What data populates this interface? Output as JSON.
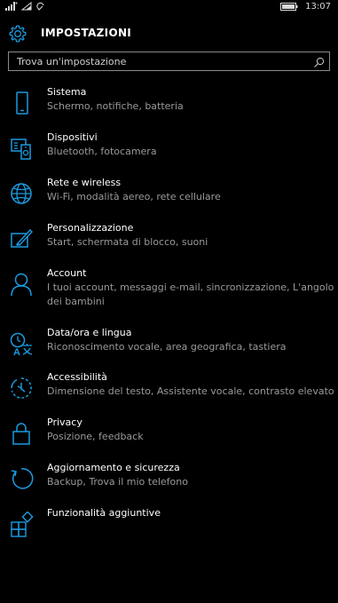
{
  "status_bar": {
    "time": "13:07",
    "icons": [
      "signal-icon",
      "wifi-icon",
      "sync-icon",
      "battery-icon"
    ]
  },
  "header": {
    "title": "IMPOSTAZIONI",
    "icon": "gear-icon"
  },
  "search": {
    "placeholder": "Trova un'impostazione",
    "value": ""
  },
  "colors": {
    "accent": "#1b9be0",
    "background": "#000000",
    "subtitle": "#9a9a9a"
  },
  "settings": [
    {
      "title": "Sistema",
      "subtitle": "Schermo, notifiche, batteria",
      "icon": "phone-icon"
    },
    {
      "title": "Dispositivi",
      "subtitle": "Bluetooth, fotocamera",
      "icon": "devices-icon"
    },
    {
      "title": "Rete e wireless",
      "subtitle": "Wi-Fi, modalità aereo, rete cellulare",
      "icon": "globe-icon"
    },
    {
      "title": "Personalizzazione",
      "subtitle": "Start, schermata di blocco, suoni",
      "icon": "personalize-icon"
    },
    {
      "title": "Account",
      "subtitle": "I tuoi account, messaggi e-mail, sincronizzazione, L'angolo dei bambini",
      "icon": "person-icon"
    },
    {
      "title": "Data/ora e lingua",
      "subtitle": "Riconoscimento vocale, area geografica, tastiera",
      "icon": "time-language-icon"
    },
    {
      "title": "Accessibilità",
      "subtitle": "Dimensione del testo, Assistente vocale, contrasto elevato",
      "icon": "accessibility-icon"
    },
    {
      "title": "Privacy",
      "subtitle": "Posizione, feedback",
      "icon": "lock-icon"
    },
    {
      "title": "Aggiornamento e sicurezza",
      "subtitle": "Backup, Trova il mio telefono",
      "icon": "update-icon"
    },
    {
      "title": "Funzionalità aggiuntive",
      "subtitle": "",
      "icon": "extras-icon"
    }
  ]
}
